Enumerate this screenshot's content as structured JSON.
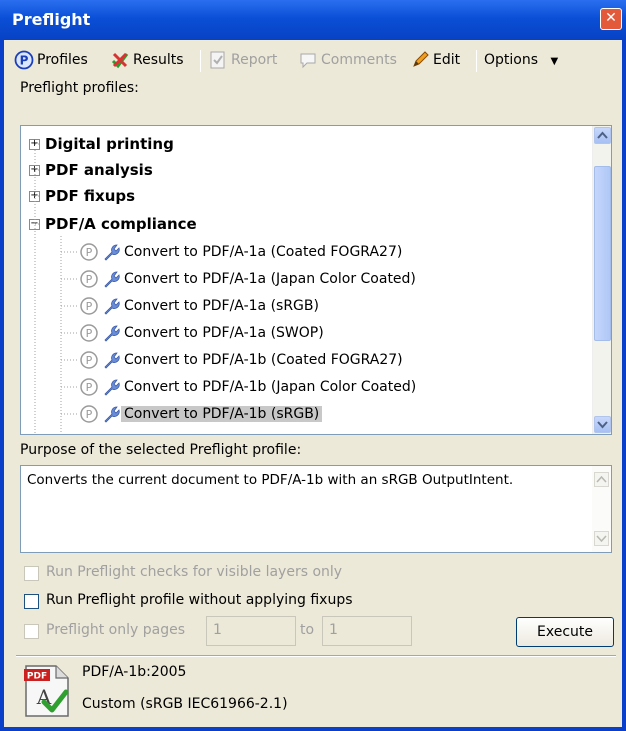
{
  "window": {
    "title": "Preflight",
    "close_glyph": "✕"
  },
  "toolbar": {
    "profiles": "Profiles",
    "results": "Results",
    "report": "Report",
    "comments": "Comments",
    "edit": "Edit",
    "options": "Options",
    "options_arrow": "▼"
  },
  "profiles_label": "Preflight profiles:",
  "tree": {
    "groups": [
      {
        "label": "Digital printing",
        "expander": "+"
      },
      {
        "label": "PDF analysis",
        "expander": "+"
      },
      {
        "label": "PDF fixups",
        "expander": "+"
      },
      {
        "label": "PDF/A compliance",
        "expander": "−"
      }
    ],
    "items": [
      "Convert to PDF/A-1a (Coated FOGRA27)",
      "Convert to PDF/A-1a (Japan Color Coated)",
      "Convert to PDF/A-1a (sRGB)",
      "Convert to PDF/A-1a (SWOP)",
      "Convert to PDF/A-1b (Coated FOGRA27)",
      "Convert to PDF/A-1b (Japan Color Coated)",
      "Convert to PDF/A-1b (sRGB)"
    ],
    "selected_index": 6
  },
  "purpose_label": "Purpose of the selected Preflight profile:",
  "purpose_text": "Converts the current document to PDF/A-1b with an sRGB OutputIntent.",
  "options": {
    "visible_layers": "Run Preflight checks for visible layers only",
    "without_fixups": "Run Preflight profile without applying fixups",
    "only_pages": "Preflight only pages",
    "from_page": "1",
    "to_label": "to",
    "to_page": "1",
    "execute": "Execute"
  },
  "footer": {
    "standard": "PDF/A-1b:2005",
    "output_intent": "Custom (sRGB IEC61966-2.1)",
    "icon_badge": "PDF",
    "icon_glyph": "A"
  },
  "colors": {
    "titlebar": "#0a4fd6",
    "selection": "#c8c8c8",
    "window_bg": "#ece9d8"
  }
}
